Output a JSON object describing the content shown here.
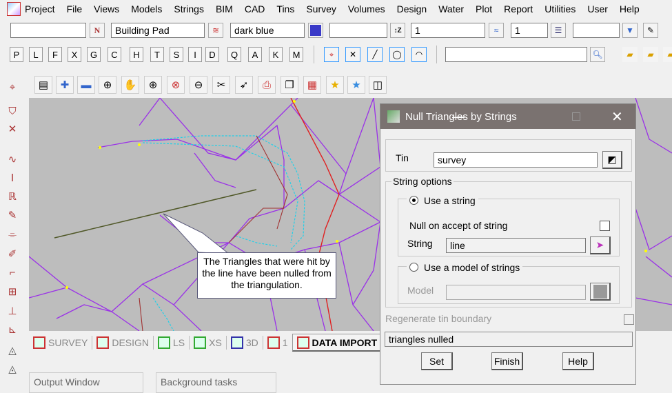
{
  "menu": [
    "Project",
    "File",
    "Views",
    "Models",
    "Strings",
    "BIM",
    "CAD",
    "Tins",
    "Survey",
    "Volumes",
    "Design",
    "Water",
    "Plot",
    "Report",
    "Utilities",
    "User",
    "Help"
  ],
  "toolbar": {
    "model": "Building Pad",
    "colour": "dark blue",
    "colour_hex": "#3a3ac8",
    "level": "1",
    "weight": "1"
  },
  "string_buttons": [
    "P",
    "L",
    "F",
    "X",
    "G",
    "C",
    "H",
    "T",
    "S",
    "I",
    "D",
    "Q",
    "A",
    "K",
    "M"
  ],
  "callout": "The Triangles that were hit by the line have been nulled from the triangulation.",
  "tabs": [
    "SURVEY",
    "DESIGN",
    "LS",
    "XS",
    "3D",
    "1",
    "DATA IMPORT"
  ],
  "panels": [
    "Output Window",
    "Background tasks"
  ],
  "dialog": {
    "title": "Null Triangles by Strings",
    "tin_label": "Tin",
    "tin_value": "survey",
    "string_options": "String options",
    "use_string": "Use a string",
    "null_on_accept": "Null on accept of string",
    "string_label": "String",
    "string_value": "line",
    "use_model": "Use a model of strings",
    "model_label": "Model",
    "model_value": "",
    "regenerate": "Regenerate tin boundary",
    "message": "triangles nulled",
    "set": "Set",
    "finish": "Finish",
    "help": "Help"
  }
}
